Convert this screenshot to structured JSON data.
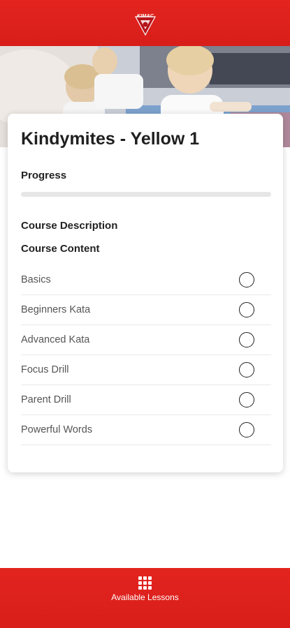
{
  "header": {
    "logo_text": "KIMAC",
    "brand_color": "#d81e1a"
  },
  "hero": {
    "image": "kids-karate-class-photo"
  },
  "course": {
    "title": "Kindymites - Yellow 1",
    "progress_label": "Progress",
    "progress_fraction": 0,
    "description_label": "Course Description",
    "content_label": "Course Content",
    "lessons": [
      {
        "name": "Basics",
        "completed": false
      },
      {
        "name": "Beginners Kata",
        "completed": false
      },
      {
        "name": "Advanced Kata",
        "completed": false
      },
      {
        "name": "Focus Drill",
        "completed": false
      },
      {
        "name": "Parent Drill",
        "completed": false
      },
      {
        "name": "Powerful Words",
        "completed": false
      }
    ]
  },
  "bottom_nav": {
    "tab_icon": "grid-icon",
    "tab_label": "Available Lessons"
  }
}
